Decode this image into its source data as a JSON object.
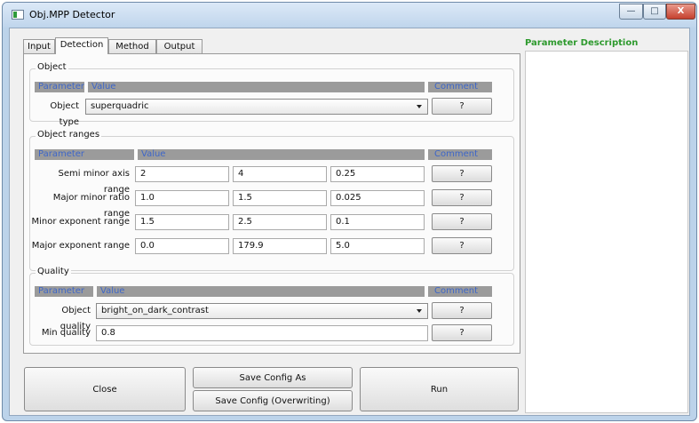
{
  "window": {
    "title": "Obj.MPP Detector",
    "min_glyph": "—",
    "max_glyph": "□",
    "close_glyph": "X"
  },
  "tabs": [
    "Input",
    "Detection",
    "Method",
    "Output"
  ],
  "active_tab": "Detection",
  "object_group": {
    "title": "Object",
    "header": {
      "parameter": "Parameter",
      "value": "Value",
      "comment": "Comment"
    },
    "type_label": "Object type",
    "type_value": "superquadric",
    "help": "?"
  },
  "ranges_group": {
    "title": "Object ranges",
    "header": {
      "parameter": "Parameter",
      "value": "Value",
      "comment": "Comment"
    },
    "rows": [
      {
        "label": "Semi minor axis range",
        "min": "2",
        "max": "4",
        "step": "0.25",
        "help": "?"
      },
      {
        "label": "Major minor ratio range",
        "min": "1.0",
        "max": "1.5",
        "step": "0.025",
        "help": "?"
      },
      {
        "label": "Minor exponent range",
        "min": "1.5",
        "max": "2.5",
        "step": "0.1",
        "help": "?"
      },
      {
        "label": "Major exponent range",
        "min": "0.0",
        "max": "179.9",
        "step": "5.0",
        "help": "?"
      }
    ]
  },
  "quality_group": {
    "title": "Quality",
    "header": {
      "parameter": "Parameter",
      "value": "Value",
      "comment": "Comment"
    },
    "quality_label": "Object quality",
    "quality_value": "bright_on_dark_contrast",
    "min_label": "Min quality",
    "min_value": "0.8",
    "help": "?"
  },
  "buttons": {
    "close": "Close",
    "save_as": "Save Config As",
    "save_overwrite": "Save Config (Overwriting)",
    "run": "Run"
  },
  "description": {
    "title": "Parameter Description",
    "text": ""
  },
  "colors": {
    "header_bar": "#9b9b9b",
    "header_text": "#3d66c8",
    "description_title": "#2e9a2e",
    "close_button": "#c5402e"
  }
}
